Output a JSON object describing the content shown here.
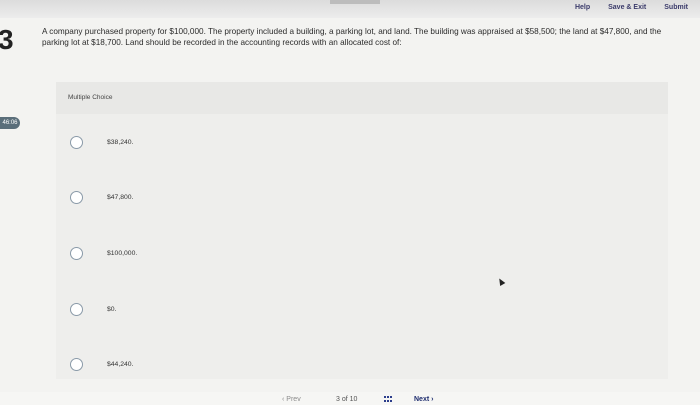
{
  "header": {
    "help_label": "Help",
    "save_exit_label": "Save & Exit",
    "submit_label": "Submit"
  },
  "question": {
    "number": "3",
    "text": "A company purchased property for $100,000. The property included a building, a parking lot, and land. The building was appraised at $58,500; the land at $47,800, and the parking lot at $18,700. Land should be recorded in the accounting records with an allocated cost of:"
  },
  "timer": {
    "value": "46:06"
  },
  "multiple_choice": {
    "title": "Multiple Choice",
    "options": [
      {
        "label": "$38,240."
      },
      {
        "label": "$47,800."
      },
      {
        "label": "$100,000."
      },
      {
        "label": "$0."
      },
      {
        "label": "$44,240."
      }
    ]
  },
  "footer": {
    "prev_label": "Prev",
    "pager_current": "3",
    "pager_of": "of",
    "pager_total": "10",
    "next_label": "Next"
  }
}
